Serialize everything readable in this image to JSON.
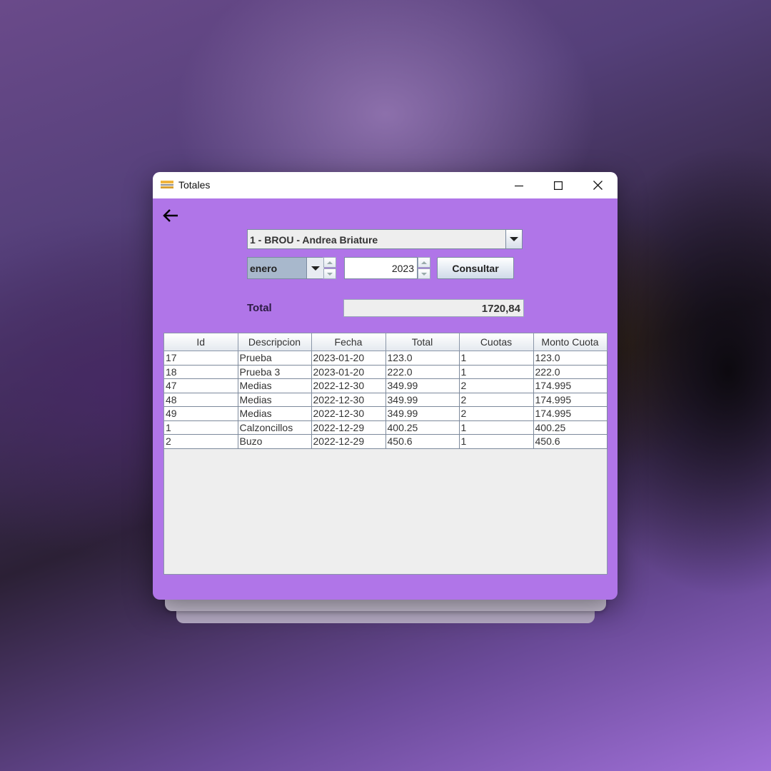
{
  "window": {
    "title": "Totales"
  },
  "controls": {
    "bank_selected": "1 - BROU - Andrea Briature",
    "month_selected": "enero",
    "year_value": "2023",
    "consultar_label": "Consultar"
  },
  "summary": {
    "total_label": "Total",
    "total_value": "1720,84"
  },
  "table": {
    "headers": [
      "Id",
      "Descripcion",
      "Fecha",
      "Total",
      "Cuotas",
      "Monto Cuota"
    ],
    "rows": [
      [
        "17",
        "Prueba",
        "2023-01-20",
        "123.0",
        "1",
        "123.0"
      ],
      [
        "18",
        "Prueba 3",
        "2023-01-20",
        "222.0",
        "1",
        "222.0"
      ],
      [
        "47",
        "Medias",
        "2022-12-30",
        "349.99",
        "2",
        "174.995"
      ],
      [
        "48",
        "Medias",
        "2022-12-30",
        "349.99",
        "2",
        "174.995"
      ],
      [
        "49",
        "Medias",
        "2022-12-30",
        "349.99",
        "2",
        "174.995"
      ],
      [
        "1",
        "Calzoncillos",
        "2022-12-29",
        "400.25",
        "1",
        "400.25"
      ],
      [
        "2",
        "Buzo",
        "2022-12-29",
        "450.6",
        "1",
        "450.6"
      ]
    ]
  },
  "icons": {
    "app": "card-icon",
    "back": "arrow-left-icon",
    "minimize": "minimize-icon",
    "maximize": "maximize-icon",
    "close": "close-icon"
  },
  "colors": {
    "window_bg": "#b075e8",
    "total_label": "#2c1b44"
  }
}
